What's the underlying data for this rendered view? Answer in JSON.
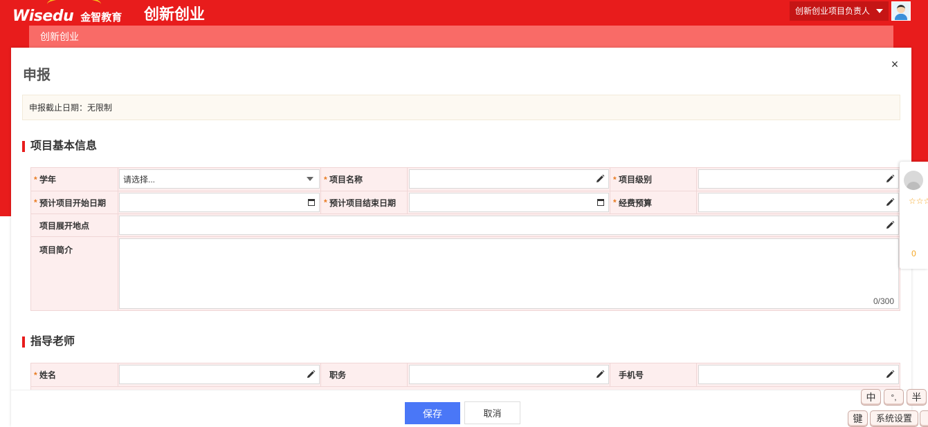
{
  "header": {
    "logo_word": "Wisedu",
    "logo_cn": "金智教育",
    "app_title": "创新创业",
    "user_role": "创新创业项目负责人"
  },
  "subnav": {
    "label": "创新创业"
  },
  "modal": {
    "title": "申报",
    "close_glyph": "×",
    "deadline": "申报截止日期：无限制"
  },
  "section_basic": {
    "title": "项目基本信息",
    "school_year_label": "学年",
    "school_year_placeholder": "请选择...",
    "project_name_label": "项目名称",
    "project_level_label": "项目级别",
    "start_date_label": "预计项目开始日期",
    "end_date_label": "预计项目结束日期",
    "budget_label": "经费预算",
    "location_label": "项目展开地点",
    "intro_label": "项目简介",
    "intro_counter": "0/300"
  },
  "section_advisor": {
    "title": "指导老师",
    "name_label": "姓名",
    "position_label": "职务",
    "phone_label": "手机号"
  },
  "footer": {
    "save_label": "保存",
    "cancel_label": "取消"
  },
  "rating": {
    "stars": "☆☆☆☆☆",
    "count": "0"
  },
  "ime": {
    "key_zh": "中",
    "key_punct": "°,",
    "key_half": "半",
    "key_keyboard": "键",
    "key_settings": "系统设置"
  },
  "colors": {
    "brand_red": "#e81c1c",
    "subnav": "#f96b67",
    "primary_button": "#4a77f7",
    "required_star": "#e87a1f"
  }
}
